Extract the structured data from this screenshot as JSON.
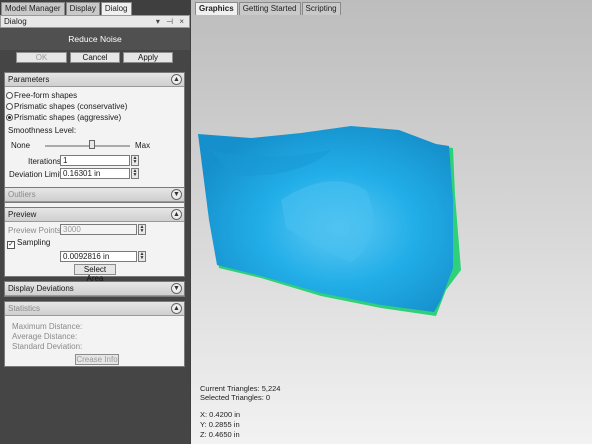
{
  "left_tabs": [
    "Model Manager",
    "Display",
    "Dialog"
  ],
  "dialog_header": {
    "title": "Dialog",
    "controls": "▾ ⊣ ×"
  },
  "dialog": {
    "title": "Reduce Noise",
    "buttons": {
      "ok": "OK",
      "cancel": "Cancel",
      "apply": "Apply"
    }
  },
  "parameters": {
    "header": "Parameters",
    "options": [
      "Free-form shapes",
      "Prismatic shapes (conservative)",
      "Prismatic shapes (aggressive)"
    ],
    "selected_option_index": 2,
    "smoothness_label": "Smoothness Level:",
    "slider_min_label": "None",
    "slider_max_label": "Max",
    "smoothness_fraction": 0.55,
    "iterations_label": "Iterations:",
    "iterations_value": "1",
    "deviation_label": "Deviation Limit:",
    "deviation_value": "0.16301 in"
  },
  "outliers": {
    "header": "Outliers"
  },
  "preview": {
    "header": "Preview",
    "points_label": "Preview Points:",
    "points_value": "3000",
    "sampling_label": "Sampling",
    "sampling_checked": true,
    "sampling_value": "0.0092816 in",
    "select_area_label": "Select Area"
  },
  "display_deviations": {
    "header": "Display Deviations"
  },
  "statistics": {
    "header": "Statistics",
    "max_distance": "Maximum Distance:",
    "avg_distance": "Average Distance:",
    "std_deviation": "Standard Deviation:",
    "crease_info_label": "Crease Info"
  },
  "right_tabs": [
    "Graphics",
    "Getting Started",
    "Scripting"
  ],
  "viewport": {
    "current_triangles": "Current Triangles: 5,224",
    "selected_triangles": "Selected Triangles: 0",
    "x": "X:  0.4200 in",
    "y": "Y:  0.2855 in",
    "z": "Z:  0.4650 in"
  },
  "colors": {
    "mesh": "#1aa6e4",
    "mesh_edge": "#2fd07a",
    "panel_dark": "#3f3f3f"
  },
  "icons": {
    "collapse": "chevron-up-icon",
    "expand": "chevron-down-icon",
    "check": "checkmark-icon"
  }
}
